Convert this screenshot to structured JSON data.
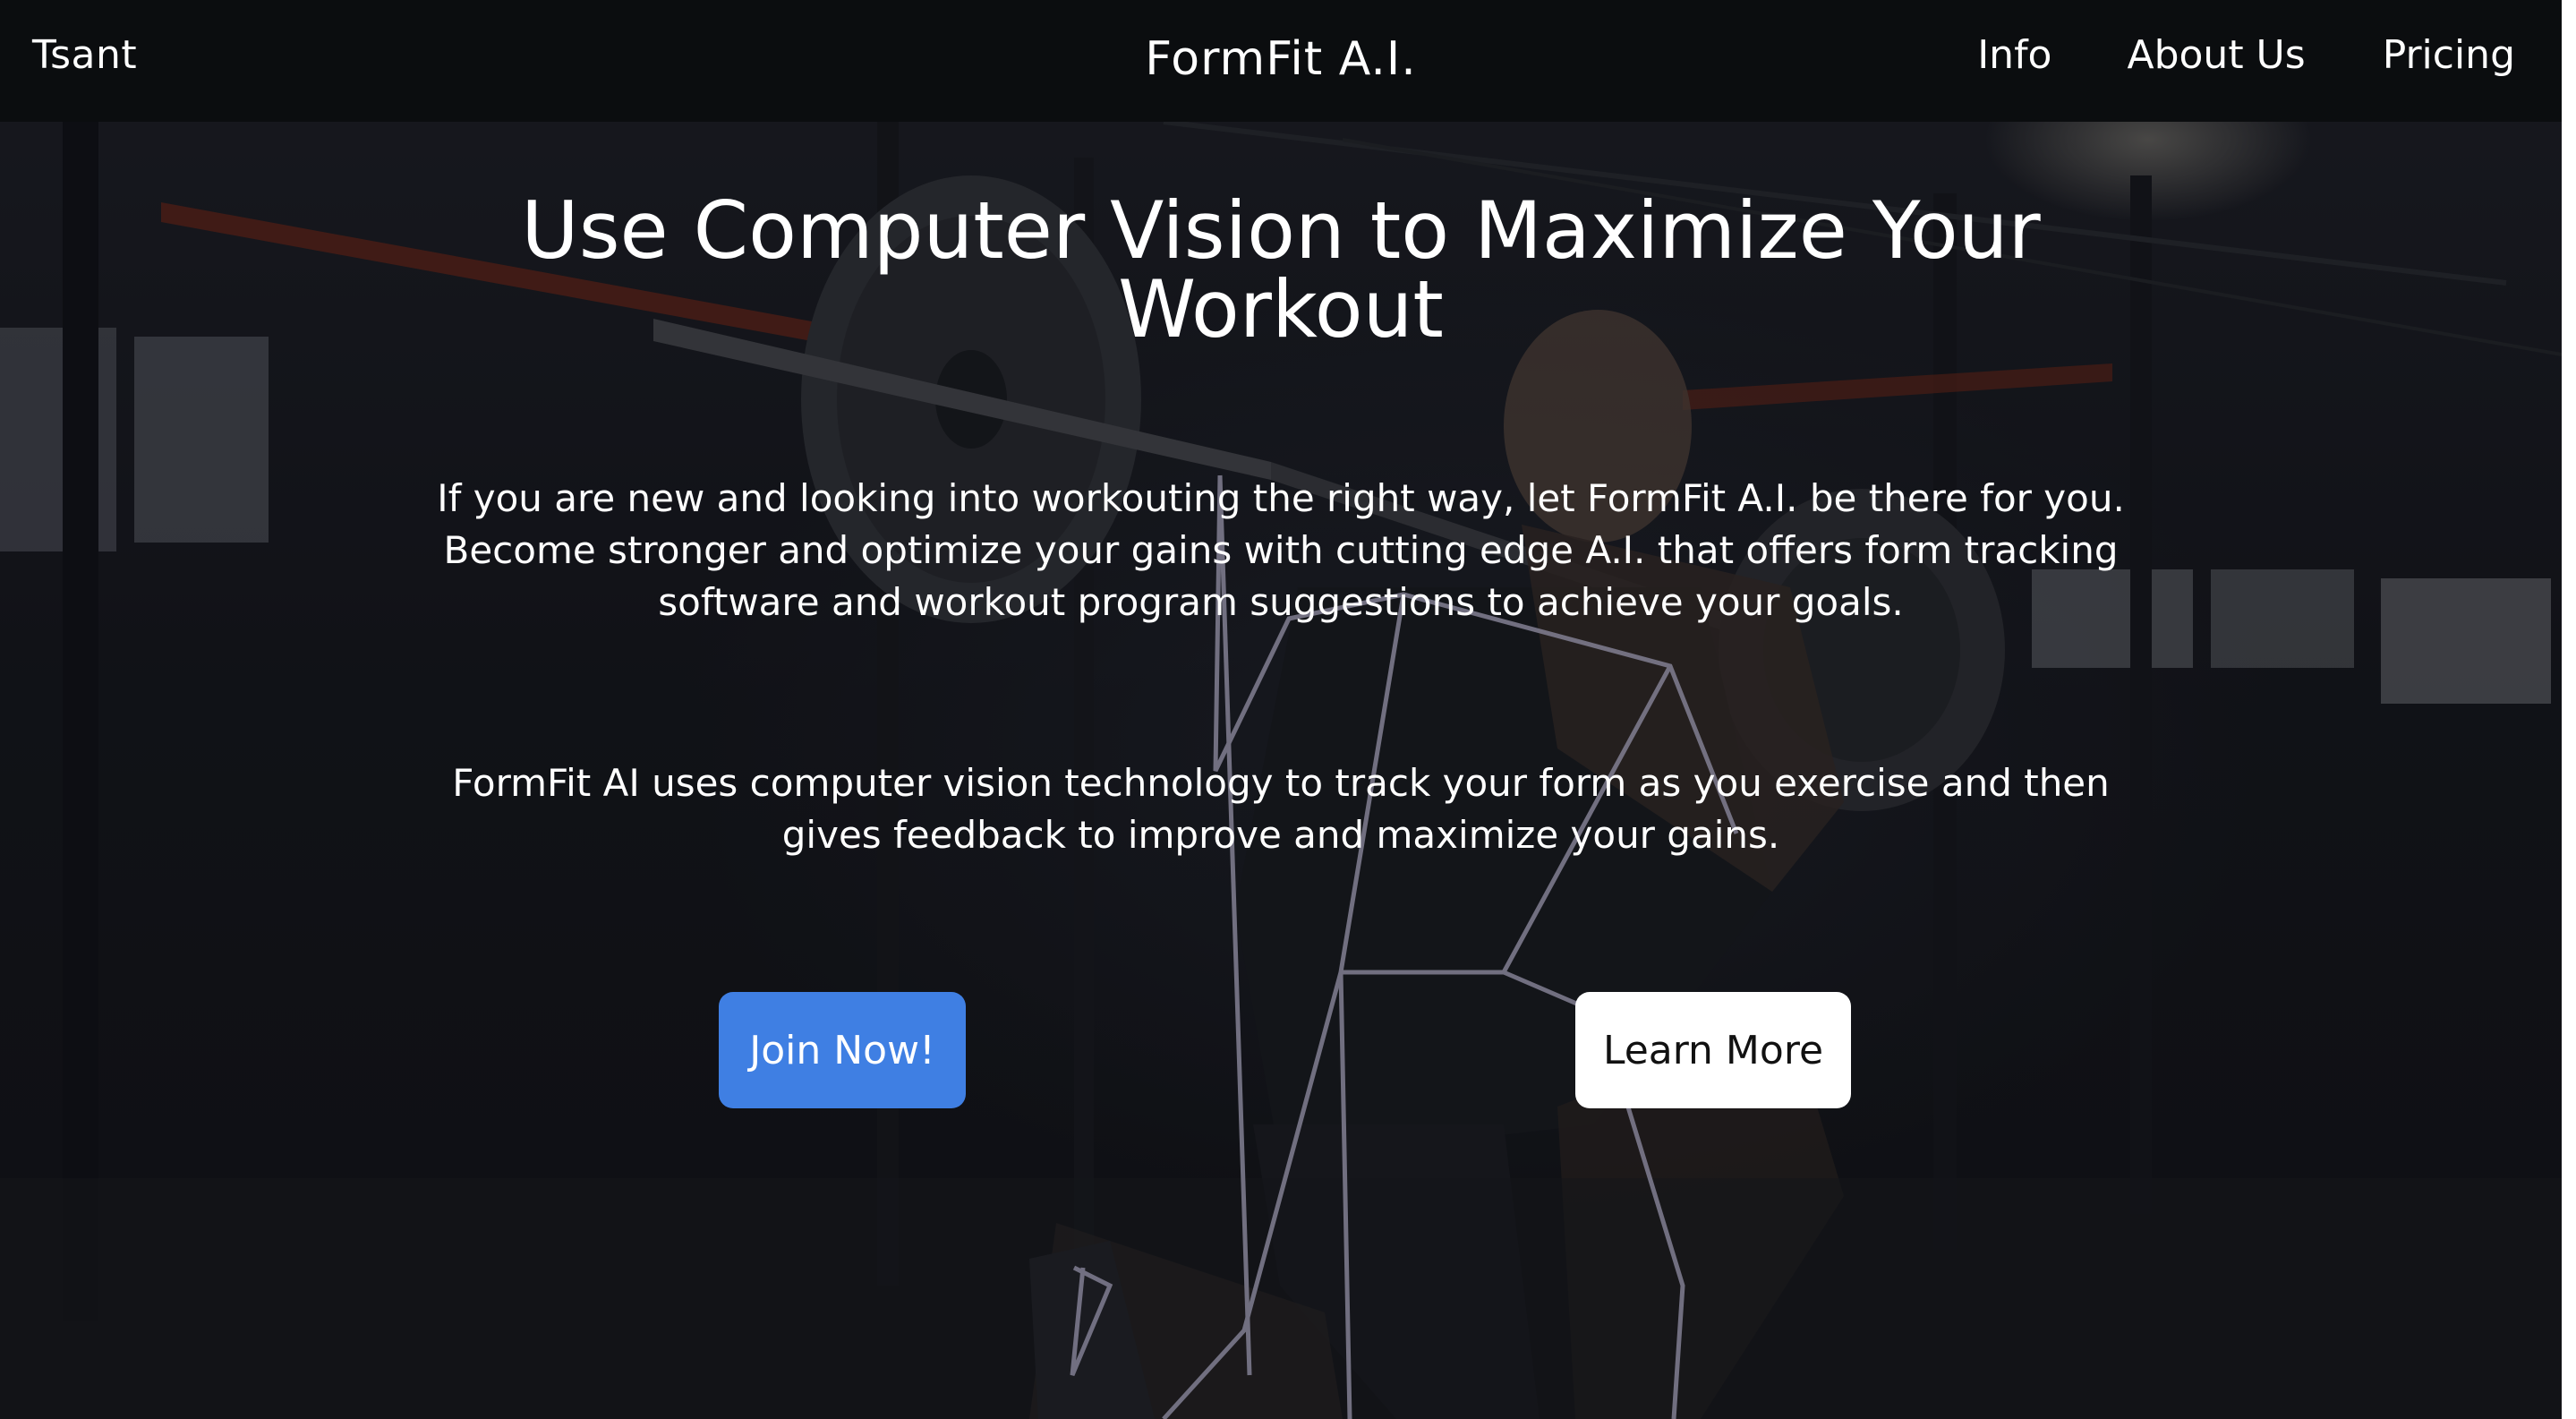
{
  "navbar": {
    "brand": "Tsant",
    "title": "FormFit A.I.",
    "links": [
      {
        "label": "Info"
      },
      {
        "label": "About Us"
      },
      {
        "label": "Pricing"
      }
    ]
  },
  "hero": {
    "headline": "Use Computer Vision to Maximize Your Workout",
    "intro": "If you are new and looking into workouting the right way, let FormFit A.I. be there for you. Become stronger and optimize your gains with cutting edge A.I. that offers form tracking software and workout program suggestions to achieve your goals.",
    "feature": "FormFit AI uses computer vision technology to track your form as you exercise and then gives feedback to improve and maximize your gains.",
    "buttons": {
      "join": "Join Now!",
      "learn_more": "Learn More"
    }
  },
  "colors": {
    "navbar_bg": "#0b0d0f",
    "join_button": "#3f7fe3",
    "learn_button": "#ffffff",
    "pose_lines": "#b9b6cf"
  }
}
